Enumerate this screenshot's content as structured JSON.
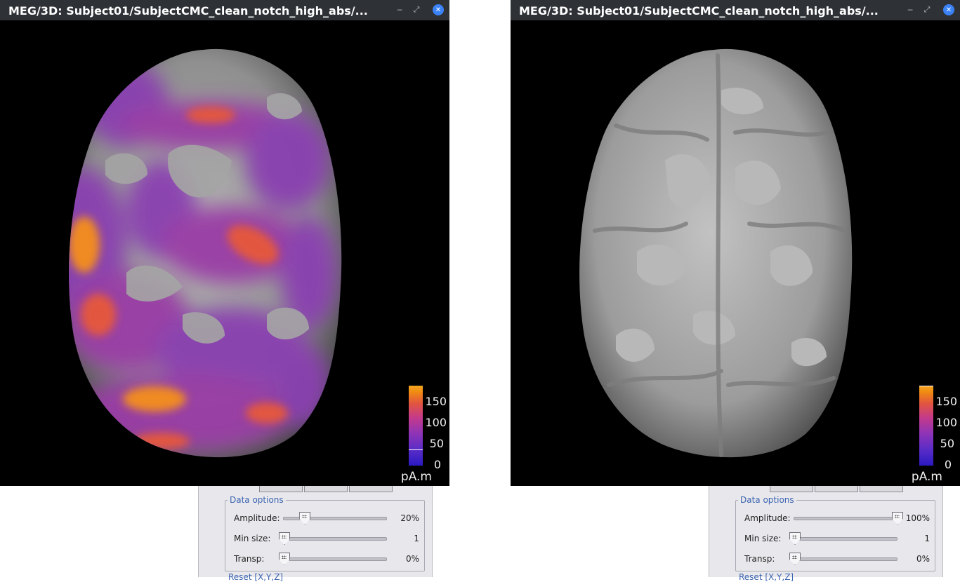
{
  "windows": [
    {
      "title": "MEG/3D: Subject01/SubjectCMC_clean_notch_high_abs/...",
      "colorbar": {
        "ticks": [
          "150",
          "100",
          "50",
          "0"
        ],
        "unit": "pA.m",
        "threshold_fraction": 0.2
      },
      "panel": {
        "group_title": "Data options",
        "rows": [
          {
            "label": "Amplitude:",
            "value": "20%",
            "level": 0.2
          },
          {
            "label": "Min size:",
            "value": "1",
            "level": 0.0
          },
          {
            "label": "Transp:",
            "value": "0%",
            "level": 0.0
          }
        ],
        "reset_label": "Reset [X,Y,Z]"
      }
    },
    {
      "title": "MEG/3D: Subject01/SubjectCMC_clean_notch_high_abs/...",
      "colorbar": {
        "ticks": [
          "150",
          "100",
          "50",
          "0"
        ],
        "unit": "pA.m",
        "threshold_fraction": 1.0
      },
      "panel": {
        "group_title": "Data options",
        "rows": [
          {
            "label": "Amplitude:",
            "value": "100%",
            "level": 1.0
          },
          {
            "label": "Min size:",
            "value": "1",
            "level": 0.0
          },
          {
            "label": "Transp:",
            "value": "0%",
            "level": 0.0
          }
        ],
        "reset_label": "Reset [X,Y,Z]"
      }
    }
  ],
  "icons": {
    "minimize": "minimize-icon",
    "maximize": "maximize-icon",
    "close": "close-icon"
  },
  "colors": {
    "titlebar": "#2e3136",
    "close_button": "#3b82f6",
    "group_title": "#3b63b0",
    "cortex_gray": "#9a9a9a"
  }
}
